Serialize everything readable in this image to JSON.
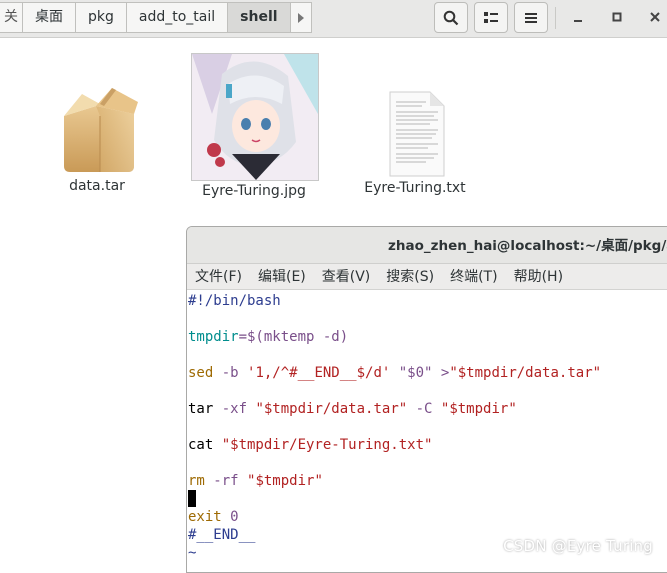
{
  "breadcrumbs": {
    "prev": "关",
    "items": [
      "桌面",
      "pkg",
      "add_to_tail",
      "shell"
    ]
  },
  "files": [
    {
      "name": "data.tar",
      "icon": "archive-box-icon"
    },
    {
      "name": "Eyre-Turing.jpg",
      "icon": "anime-girl-image-thumbnail"
    },
    {
      "name": "Eyre-Turing.txt",
      "icon": "text-document-icon"
    }
  ],
  "terminal": {
    "title": "zhao_zhen_hai@localhost:~/桌面/pkg/add",
    "menu": [
      "文件(F)",
      "编辑(E)",
      "查看(V)",
      "搜索(S)",
      "终端(T)",
      "帮助(H)"
    ],
    "code": {
      "l1": "#!/bin/bash",
      "l2_var": "tmpdir",
      "l2_rest": "=$(mktemp -d)",
      "l3_cmd": "sed",
      "l3_flag": " -b ",
      "l3_str": "'1,/^#__END__$/d'",
      "l3_mid": " \"$0\" >",
      "l3_str2": "\"$tmpdir/data.tar\"",
      "l4_cmd": "tar",
      "l4_flag": " -xf ",
      "l4_str": "\"$tmpdir/data.tar\"",
      "l4_flag2": " -C ",
      "l4_str2": "\"$tmpdir\"",
      "l5_cmd": "cat ",
      "l5_str": "\"$tmpdir/Eyre-Turing.txt\"",
      "l6_cmd": "rm",
      "l6_flag": " -rf ",
      "l6_str": "\"$tmpdir\"",
      "l7_cmd": "exit",
      "l7_val": " 0",
      "l8": "#__END__",
      "l9": "~"
    }
  },
  "watermark": "CSDN @Eyre Turing",
  "colors": {
    "accent": "#008d8d",
    "string": "#b22222",
    "keyword": "#9e6a03"
  }
}
